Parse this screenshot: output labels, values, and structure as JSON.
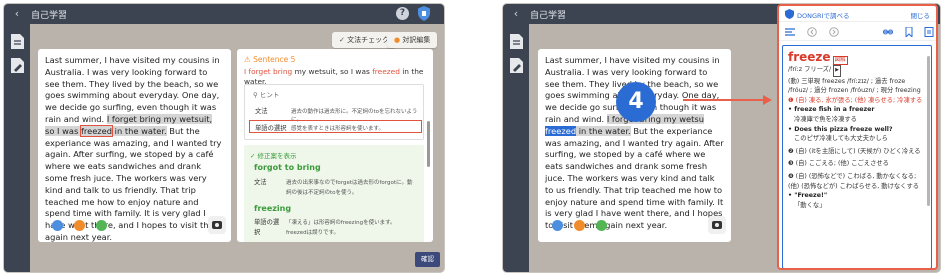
{
  "left": {
    "title": "自己学習",
    "toolbar": {
      "grammar_check": "文法チェック",
      "compare_edit": "対訳編集"
    },
    "text_before": "Last summer, I have visited my cousins in Australia. I was very looking forward to see them. They lived by the beach, so we goes swimming about everyday. One day, we decide go surfing, even though it was rain and wind.",
    "text_hl_a": "I forget bring my wetsuit, so I was ",
    "text_hl_word": "freezed",
    "text_hl_b": " in the water.",
    "text_after": "But the experiance was amazing, and I wanted try again. After surfing, we stoped by a café where we eats sandwiches and drank some fresh juce. The workers was very kind and talk to us friendly. That trip teached me how to enjoy nature and spend time with family. It is very glad I have went there, and I hopes to visit them again next year.",
    "check": {
      "section": "Sentence 5",
      "sentence_a": "I forget bring",
      "sentence_b": " my wetsuit, so I was ",
      "sentence_c": "freezed",
      "sentence_d": " in the water.",
      "hint": "ヒント",
      "row1_label": "文法",
      "row1_text": "過去の動作は過去形に。不定詞のtoを忘れないように。",
      "row2_label": "単語の選択",
      "row2_text": "感覚を表すときは形容詞を使います。",
      "fix_label": "修正案を表示",
      "fix1_word": "forgot to bring",
      "fix1_label": "文法",
      "fix1_text": "過去の出来事なのでforgetは過去形のforgotに。動詞の後は不定詞のtoを使う。",
      "fix2_word": "freezing",
      "fix2_label": "単語の選",
      "fix2_text": "「凍える」は形容詞のfreezingを使います。",
      "fix2_label2": "択",
      "fix2_text2": "freezedは誤りです。"
    },
    "confirm": "確認"
  },
  "right": {
    "title": "自己学習",
    "text_before": "Last summer, I have visited my cousins in Australia. I was very looking forward to see them. They lived by the beach, so we goes swimming about everyday. One day, we decide go surfing, even though it was rain and wind.",
    "text_hl_a": "I forget bring my wetsu",
    "text_hl_word": "freezed",
    "text_hl_b": " in the water.",
    "text_after": "But the experiance was amazing, and I wanted try again. After surfing, we stoped by a café where we eats sandwiches and drank some fresh juce. The workers was very kind and talk to us friendly. That trip teached me how to enjoy nature and spend time with family. It is very glad I have went there, and I hopes to visit them again next year.",
    "callout": "4",
    "dict": {
      "header": "DONGRIで調べる",
      "close": "閉じる",
      "headword": "freeze",
      "badge": "図解",
      "pron": "/fríːz フリーズ/",
      "forms": "(動) 三単現 freezes /fríːzɪz/ ; 過去 froze /fróuz/ ; 過分 frozen /fróuzn/ ; 現分 freezing",
      "s1": "❶ (自) 凍る, 氷が張る; (他) 凍らせる; 冷凍する",
      "e1": "• freeze fish in a freezer",
      "e1t": "冷凍庫で魚を冷凍する",
      "e2": "• Does this pizza freeze well?",
      "e2t": "このピザ冷凍しても大丈夫かしら",
      "s2": "❷ (自) (itを主語にして) (天候が) ひどく冷える",
      "s3": "❸ (自) こごえる; (他) こごえさせる",
      "s4": "❹ (自) (恐怖などで) こわばる, 動かなくなる; (他) (恐怖などが) こわばらせる, 動けなくする",
      "e3": "• \"Freeze!\"",
      "e3t": "「動くな」"
    }
  },
  "colors": {
    "accent": "#2b6cd4",
    "alert": "#e0533f",
    "ok": "#3d9b3d",
    "dict_border": "#e8604a"
  }
}
